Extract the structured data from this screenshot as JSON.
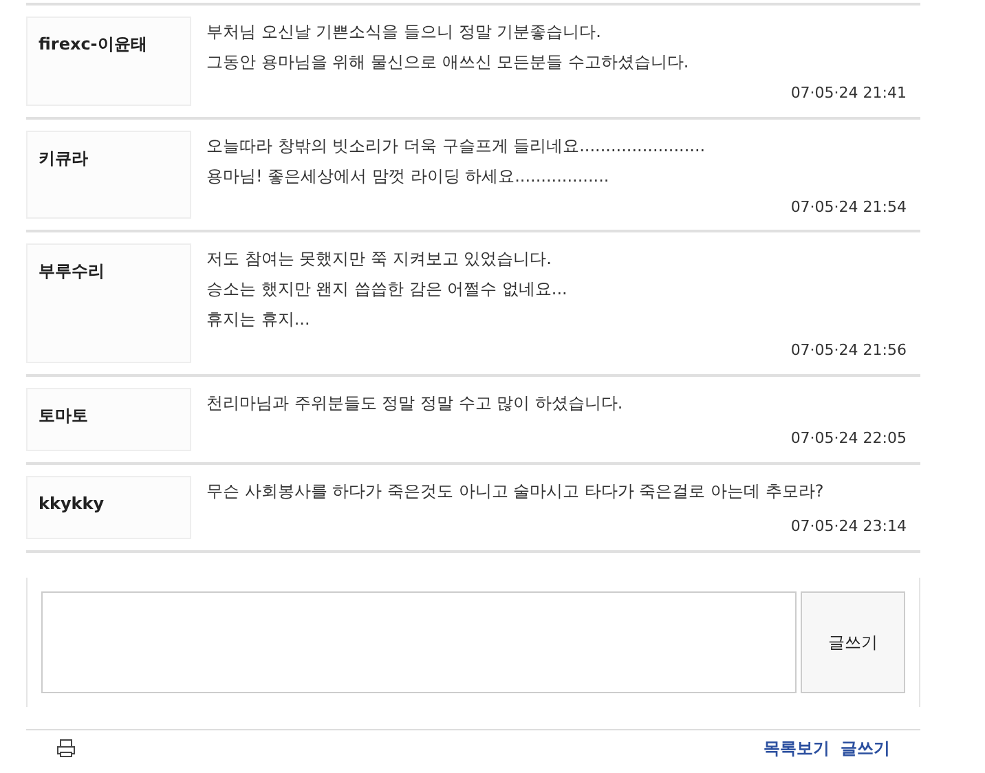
{
  "comments": [
    {
      "author": "firexc-이윤태",
      "lines": [
        "부처님 오신날 기쁜소식을 들으니 정말 기분좋습니다.",
        "그동안 용마님을 위해 물신으로 애쓰신 모든분들 수고하셨습니다."
      ],
      "time": "07·05·24 21:41"
    },
    {
      "author": "키큐라",
      "lines": [
        "오늘따라 창밖의 빗소리가 더욱 구슬프게 들리네요........................",
        "용마님! 좋은세상에서 맘껏 라이딩 하세요.................."
      ],
      "time": "07·05·24 21:54"
    },
    {
      "author": "부루수리",
      "lines": [
        "저도 참여는 못했지만 쭉 지켜보고 있었습니다.",
        "승소는 했지만 왠지 씁씁한 감은 어쩔수 없네요...",
        "휴지는 휴지..."
      ],
      "time": "07·05·24 21:56"
    },
    {
      "author": "토마토",
      "lines": [
        "천리마님과 주위분들도 정말 정말 수고 많이 하셨습니다."
      ],
      "time": "07·05·24 22:05"
    },
    {
      "author": "kkykky",
      "lines": [
        "무슨 사회봉사를 하다가 죽은것도 아니고 술마시고 타다가 죽은걸로 아는데 추모라?"
      ],
      "time": "07·05·24 23:14"
    }
  ],
  "write": {
    "button": "글쓰기"
  },
  "footer": {
    "links": [
      "목록보기",
      "글쓰기"
    ]
  }
}
